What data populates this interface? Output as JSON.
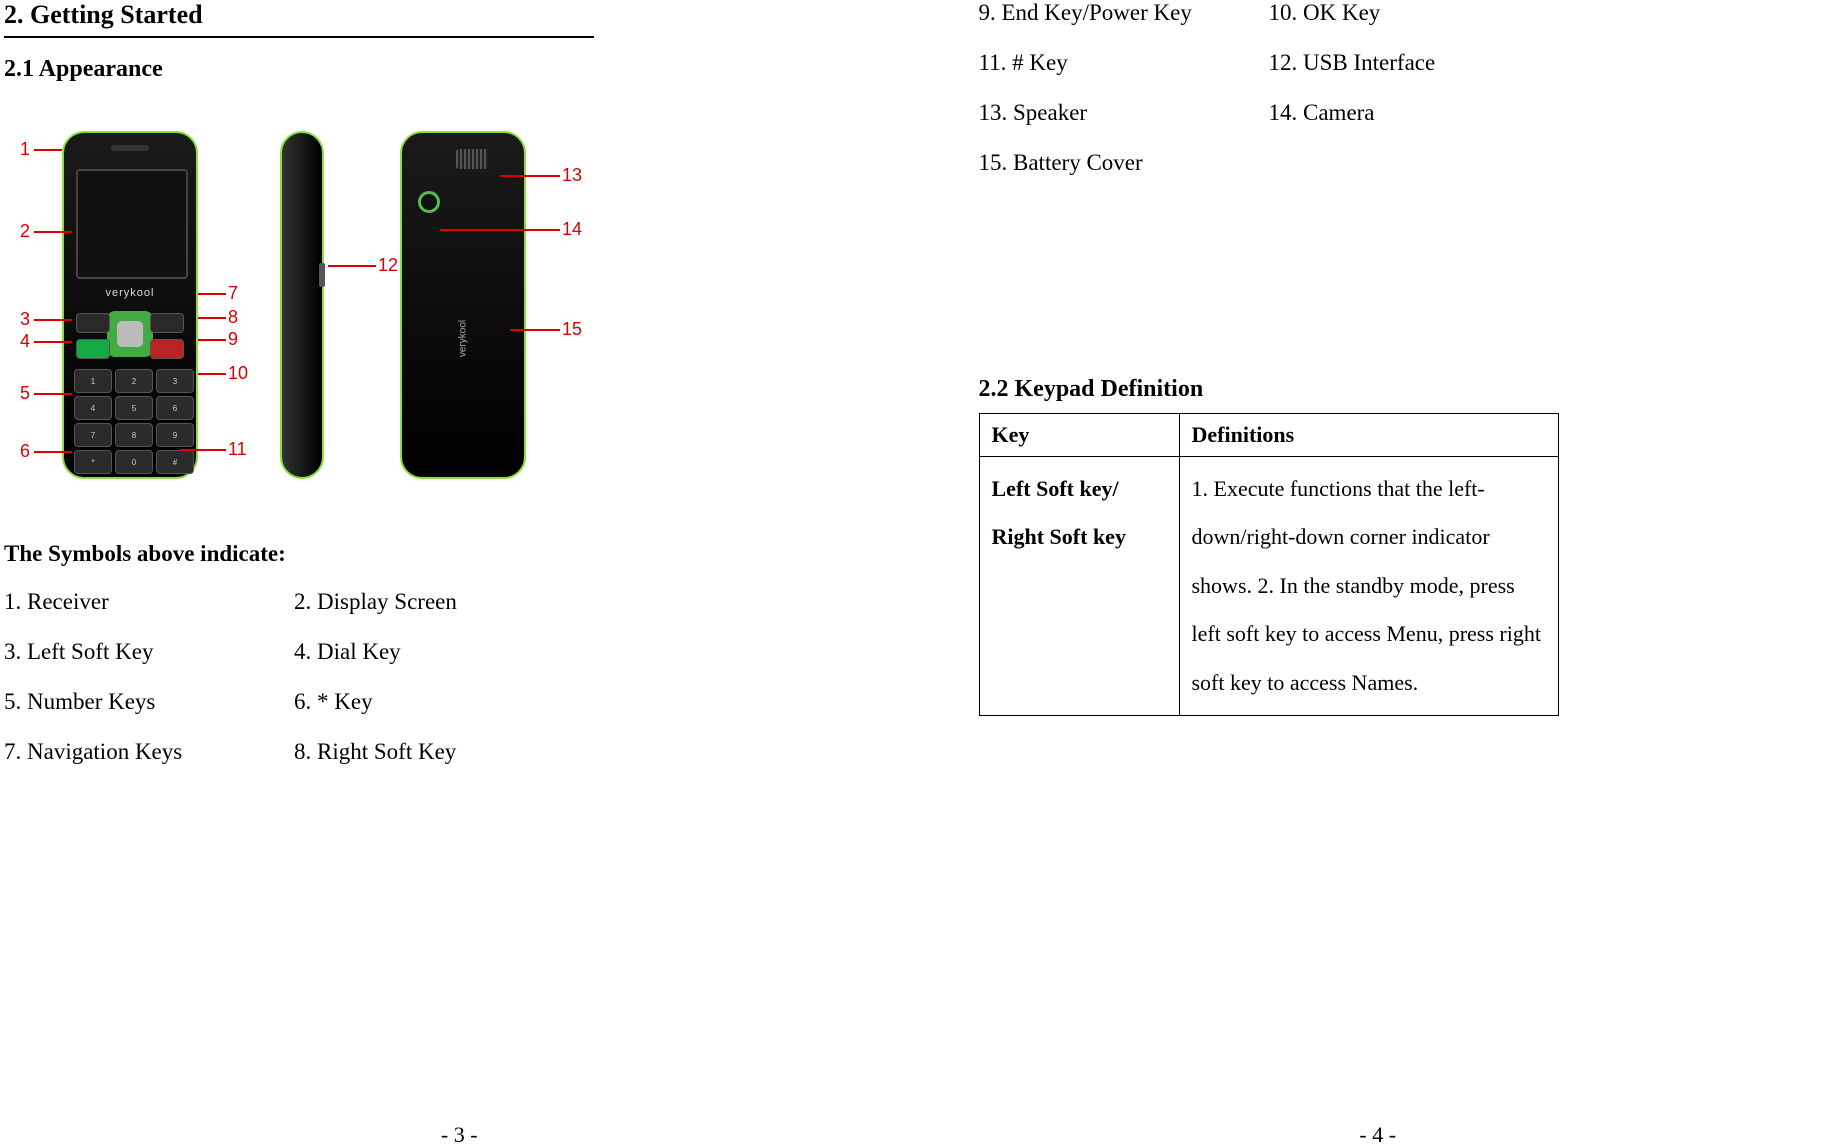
{
  "left_page": {
    "heading": "2. Getting Started",
    "subheading": "2.1 Appearance",
    "symbols_heading": "The Symbols above indicate:",
    "symbols": [
      "1. Receiver",
      "2. Display Screen",
      "3. Left Soft Key",
      "4. Dial Key",
      "5. Number Keys",
      "6. * Key",
      "7. Navigation Keys",
      "8. Right Soft Key"
    ],
    "page_number": "- 3 -",
    "brand": "verykool"
  },
  "right_page": {
    "symbols_continued": [
      "9. End Key/Power Key",
      "10. OK Key",
      "11. # Key",
      "12. USB Interface",
      "13. Speaker",
      "14. Camera",
      "15. Battery Cover",
      ""
    ],
    "subheading": "2.2 Keypad Definition",
    "table": {
      "header_key": "Key",
      "header_def": "Definitions",
      "row1_key": "Left Soft key/ Right Soft key",
      "row1_def": "1. Execute functions that the left-down/right-down corner indicator shows.\n2. In the standby mode, press left soft key to access Menu, press right soft key to access Names."
    },
    "page_number": "- 4 -"
  },
  "callouts": {
    "c1": "1",
    "c2": "2",
    "c3": "3",
    "c4": "4",
    "c5": "5",
    "c6": "6",
    "c7": "7",
    "c8": "8",
    "c9": "9",
    "c10": "10",
    "c11": "11",
    "c12": "12",
    "c13": "13",
    "c14": "14",
    "c15": "15"
  }
}
